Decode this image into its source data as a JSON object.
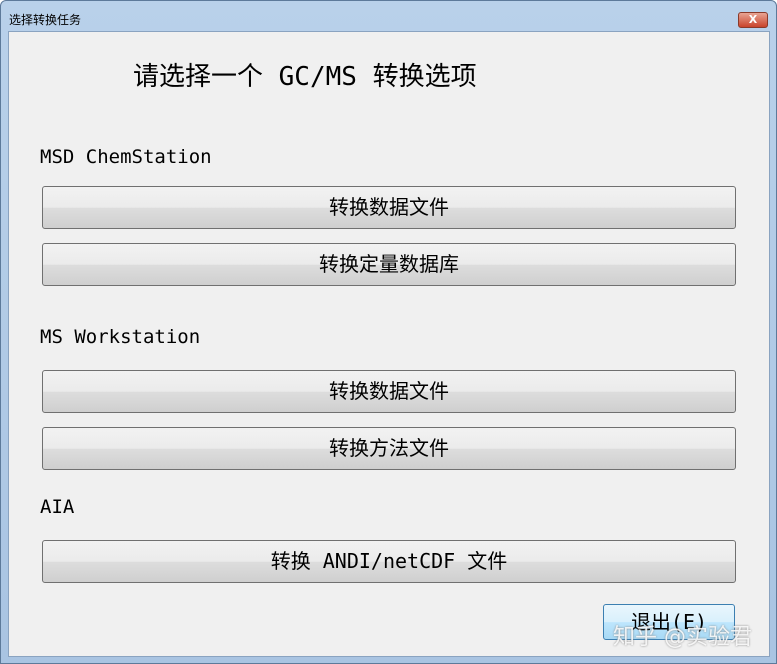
{
  "window": {
    "title": "选择转换任务",
    "close_label": "X"
  },
  "heading": "请选择一个 GC/MS 转换选项",
  "sections": [
    {
      "label": "MSD ChemStation",
      "buttons": [
        "转换数据文件",
        "转换定量数据库"
      ]
    },
    {
      "label": "MS Workstation",
      "buttons": [
        "转换数据文件",
        "转换方法文件"
      ]
    },
    {
      "label": "AIA",
      "buttons": [
        "转换 ANDI/netCDF 文件"
      ]
    }
  ],
  "exit_label": "退出(E)",
  "watermark": "知乎 @实验君"
}
